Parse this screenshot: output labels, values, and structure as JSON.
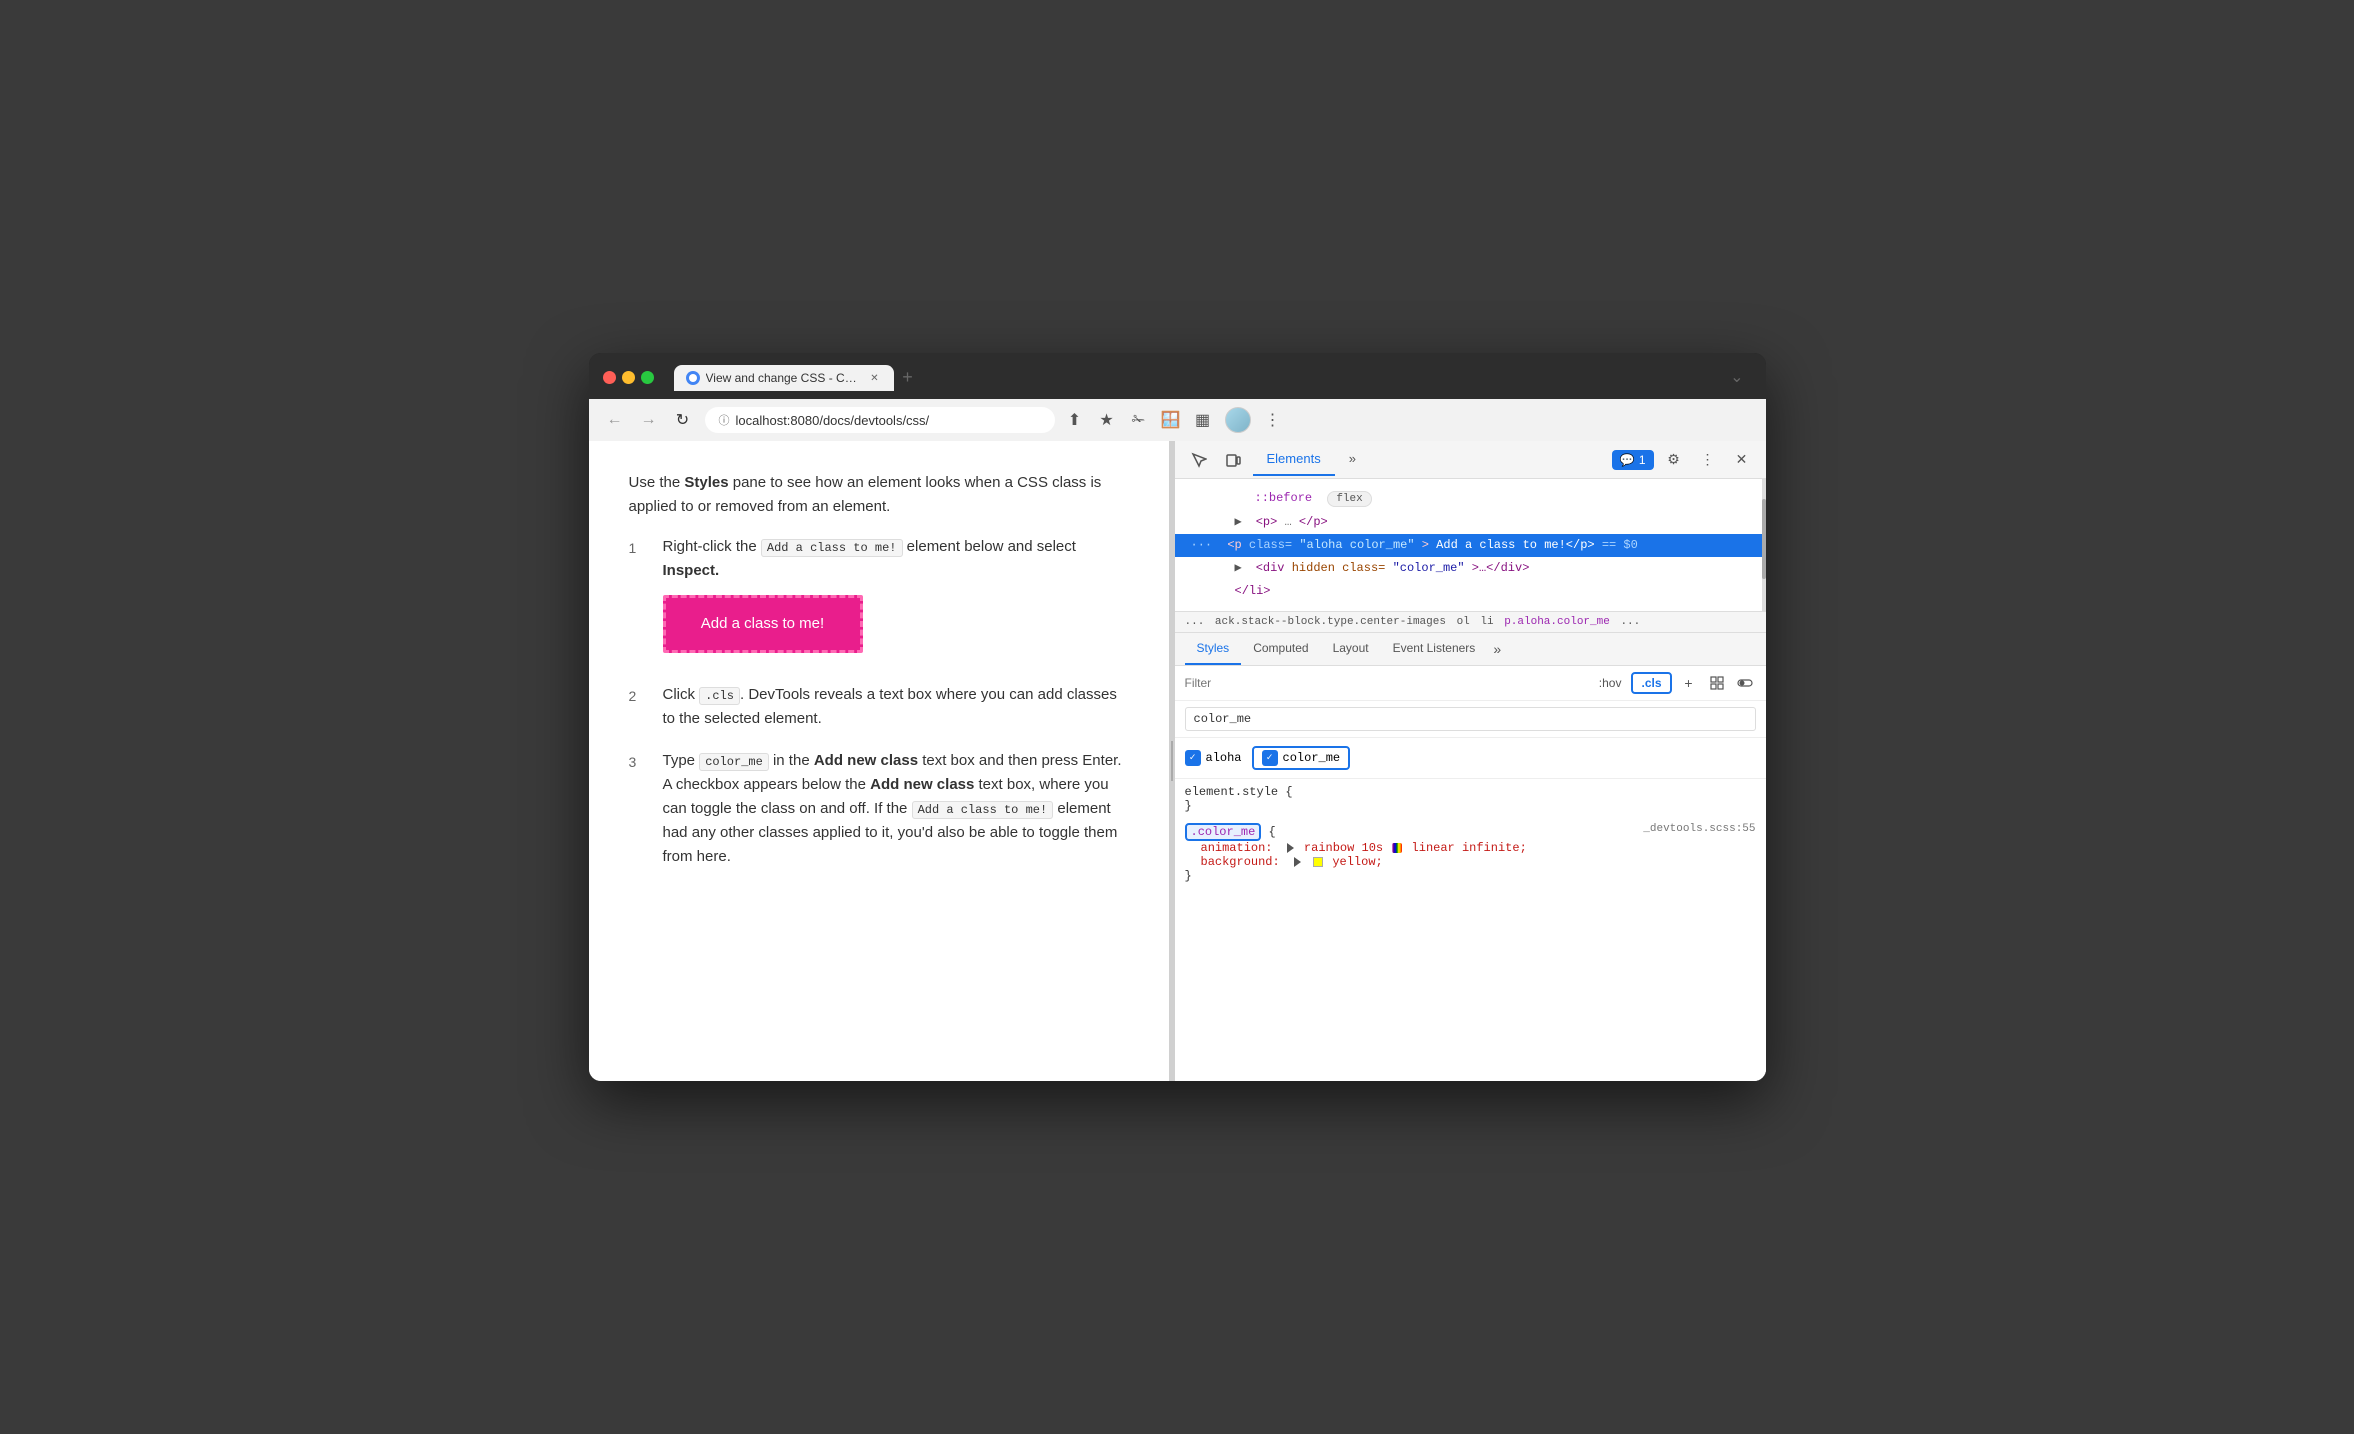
{
  "browser": {
    "tab_title": "View and change CSS - Chrom...",
    "url": "localhost:8080/docs/devtools/css/",
    "new_tab_label": "+",
    "tab_overflow": "⌄"
  },
  "left_panel": {
    "intro": "Use the ",
    "intro_bold": "Styles",
    "intro_rest": " pane to see how an element looks when a CSS class is applied to or removed from an element.",
    "steps": [
      {
        "number": "1",
        "text_before": "Right-click the ",
        "code": "Add a class to me!",
        "text_after": " element below and select ",
        "bold": "Inspect."
      },
      {
        "number": "2",
        "text_before": "Click ",
        "code": ".cls",
        "text_mid": ". DevTools reveals a text box where you can add classes to the selected element."
      },
      {
        "number": "3",
        "text_before": "Type ",
        "code": "color_me",
        "text_mid": " in the ",
        "bold_mid": "Add new class",
        "text_after": " text box and then press Enter. A checkbox appears below the ",
        "bold_after": "Add new class",
        "text_end": " text box, where you can toggle the class on and off. If the ",
        "code2": "Add a class to me!",
        "text_final": " element had any other classes applied to it, you'd also be able to toggle them from here."
      }
    ],
    "demo_button_label": "Add a class to me!"
  },
  "devtools": {
    "tabs": [
      "Elements",
      "»"
    ],
    "active_tab": "Elements",
    "header_tools": [
      "cursor",
      "box",
      "chat"
    ],
    "chat_badge": "1",
    "settings_icon": "⚙",
    "more_icon": "⋮",
    "close_icon": "✕",
    "dom": {
      "lines": [
        {
          "content": "::before",
          "type": "pseudo",
          "extra": "flex"
        },
        {
          "content": "<p>…</p>",
          "type": "element"
        },
        {
          "content": "<p class=\"aloha color_me\">Add a class to me!</p> == $0",
          "type": "selected"
        },
        {
          "content": "<div hidden class=\"color_me\">…</div>",
          "type": "element",
          "indent": true
        },
        {
          "content": "</li>",
          "type": "element",
          "indent": false
        }
      ]
    },
    "breadcrumb": {
      "items": [
        "...",
        "ack.stack--block.type.center-images",
        "ol",
        "li",
        "p.aloha.color_me",
        "..."
      ]
    },
    "styles_tabs": [
      "Styles",
      "Computed",
      "Layout",
      "Event Listeners",
      "»"
    ],
    "active_styles_tab": "Styles",
    "filter_placeholder": "Filter",
    "hov_label": ":hov",
    "cls_label": ".cls",
    "class_input_value": "color_me",
    "classes": [
      {
        "name": "aloha",
        "checked": true
      },
      {
        "name": "color_me",
        "checked": true,
        "highlighted": true
      }
    ],
    "css_rules": [
      {
        "selector": "element.style",
        "source": "",
        "properties": []
      },
      {
        "selector": ".color_me",
        "source": "_devtools.scss:55",
        "properties": [
          {
            "prop": "animation:",
            "value": "rainbow 10s",
            "extra": "linear infinite;"
          },
          {
            "prop": "background:",
            "value": "yellow;"
          }
        ]
      }
    ]
  }
}
